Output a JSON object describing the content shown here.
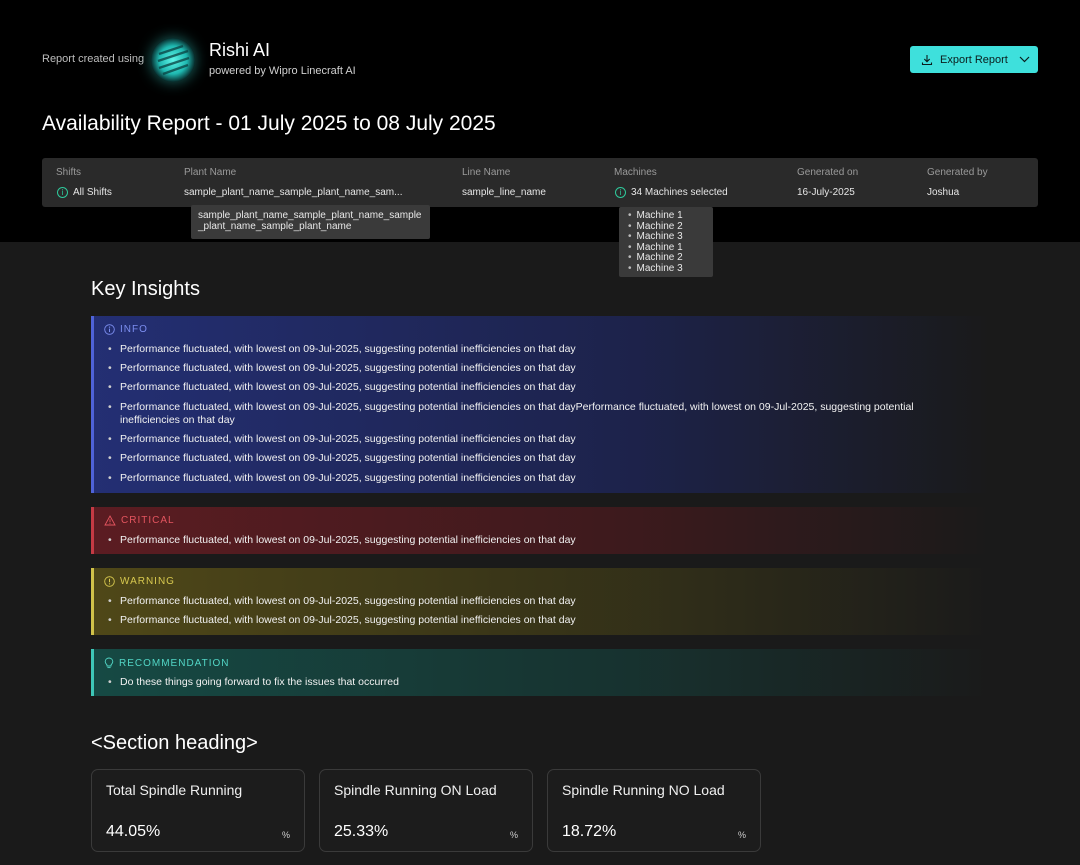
{
  "header": {
    "created_label": "Report created using",
    "brand_name": "Rishi AI",
    "brand_sub": "powered by Wipro Linecraft AI",
    "export_label": "Export Report",
    "title": "Availability Report - 01 July 2025 to 08 July 2025"
  },
  "meta": {
    "shifts": {
      "label": "Shifts",
      "value": "All Shifts"
    },
    "plant": {
      "label": "Plant Name",
      "value": "sample_plant_name_sample_plant_name_sam..."
    },
    "line": {
      "label": "Line Name",
      "value": "sample_line_name"
    },
    "machines": {
      "label": "Machines",
      "value": "34 Machines selected"
    },
    "generated_on": {
      "label": "Generated on",
      "value": "16-July-2025"
    },
    "generated_by": {
      "label": "Generated by",
      "value": "Joshua"
    }
  },
  "tooltips": {
    "plant_full": "sample_plant_name_sample_plant_name_sample_plant_name_sample_plant_name",
    "machines": [
      "Machine 1",
      "Machine 2",
      "Machine 3",
      "Machine 1",
      "Machine 2",
      "Machine 3"
    ]
  },
  "key_insights": {
    "title": "Key Insights",
    "info": {
      "label": "INFO",
      "items": [
        "Performance fluctuated, with lowest on 09-Jul-2025, suggesting potential inefficiencies on that day",
        "Performance fluctuated, with lowest on 09-Jul-2025, suggesting potential inefficiencies on that day",
        "Performance fluctuated, with lowest on 09-Jul-2025, suggesting potential inefficiencies on that day",
        "Performance fluctuated, with lowest on 09-Jul-2025, suggesting potential inefficiencies on that dayPerformance fluctuated, with lowest on 09-Jul-2025, suggesting potential inefficiencies on that day",
        "Performance fluctuated, with lowest on 09-Jul-2025, suggesting potential inefficiencies on that day",
        "Performance fluctuated, with lowest on 09-Jul-2025, suggesting potential inefficiencies on that day",
        "Performance fluctuated, with lowest on 09-Jul-2025, suggesting potential inefficiencies on that day"
      ]
    },
    "critical": {
      "label": "CRITICAL",
      "items": [
        "Performance fluctuated, with lowest on 09-Jul-2025, suggesting potential inefficiencies on that day"
      ]
    },
    "warning": {
      "label": "WARNING",
      "items": [
        "Performance fluctuated, with lowest on 09-Jul-2025, suggesting potential inefficiencies on that day",
        "Performance fluctuated, with lowest on 09-Jul-2025, suggesting potential inefficiencies on that day"
      ]
    },
    "recommendation": {
      "label": "RECOMMENDATION",
      "items": [
        "Do these things going forward to fix the issues that occurred"
      ]
    }
  },
  "section": {
    "heading": "<Section heading>",
    "cards": [
      {
        "title": "Total Spindle Running",
        "value": "44.05%",
        "unit": "%"
      },
      {
        "title": "Spindle Running ON Load",
        "value": "25.33%",
        "unit": "%"
      },
      {
        "title": "Spindle Running NO Load",
        "value": "18.72%",
        "unit": "%"
      }
    ]
  },
  "colors": {
    "accent": "#3ee0dc",
    "info": "#4f63d8",
    "critical": "#c43a44",
    "warning": "#d1c24a",
    "recommendation": "#3ec7b8"
  }
}
